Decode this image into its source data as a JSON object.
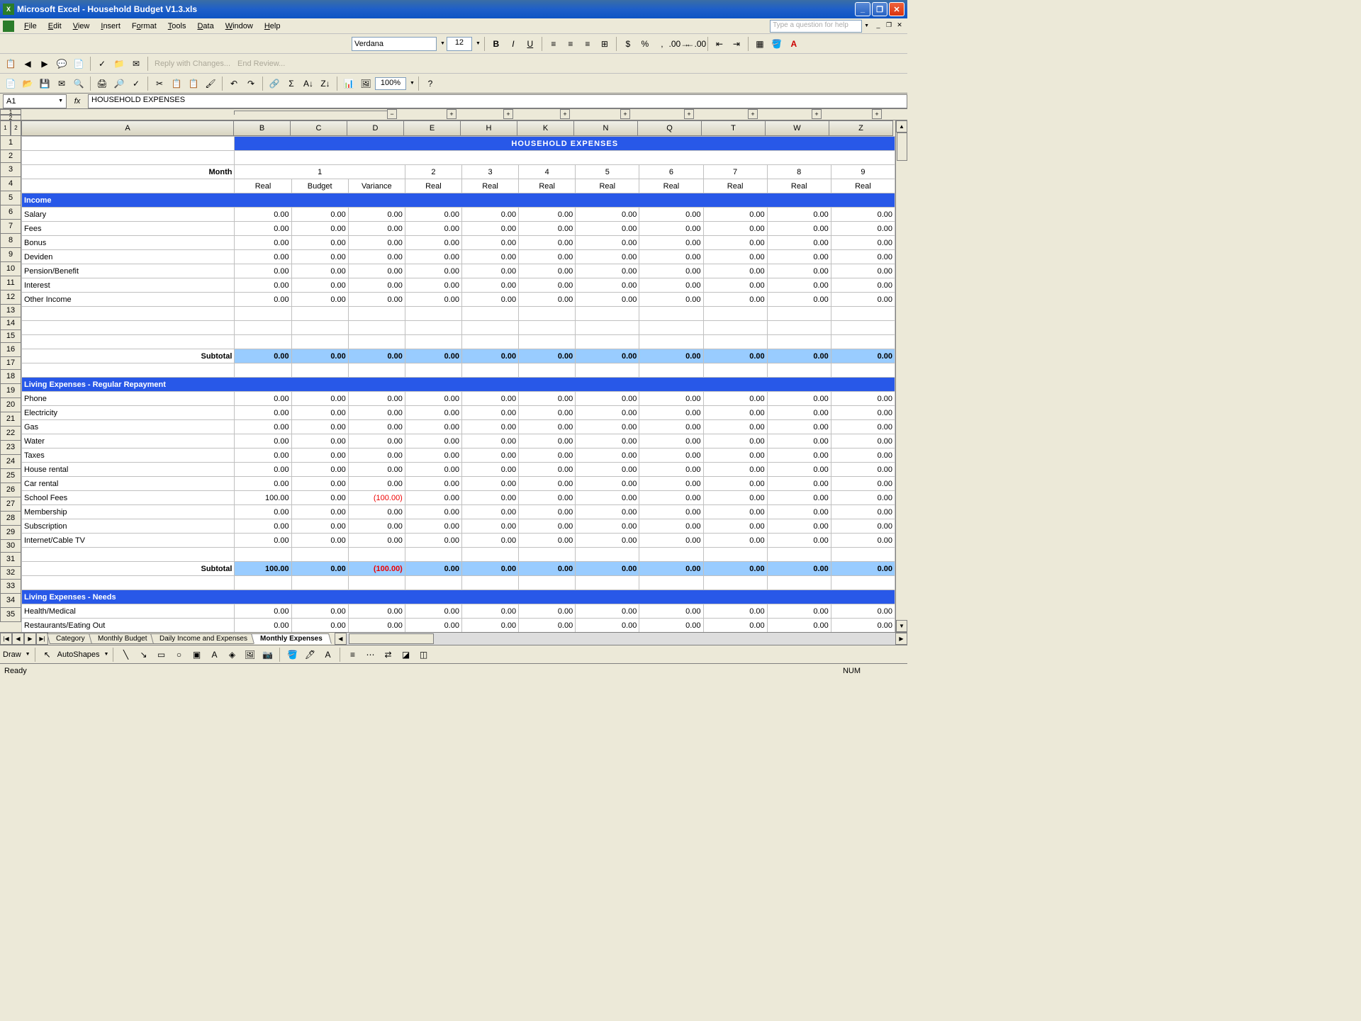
{
  "app": {
    "title": "Microsoft Excel - Household Budget V1.3.xls"
  },
  "menu": {
    "file": "File",
    "edit": "Edit",
    "view": "View",
    "insert": "Insert",
    "format": "Format",
    "tools": "Tools",
    "data": "Data",
    "window": "Window",
    "help": "Help",
    "help_box": "Type a question for help"
  },
  "font": {
    "name": "Verdana",
    "size": "12"
  },
  "toolbar2_text1": "Reply with Changes...",
  "toolbar2_text2": "End Review...",
  "zoom": "100%",
  "namebox": "A1",
  "fx": "fx",
  "formula": "HOUSEHOLD EXPENSES",
  "columns": [
    "A",
    "B",
    "C",
    "D",
    "E",
    "H",
    "K",
    "N",
    "Q",
    "T",
    "W",
    "Z"
  ],
  "row_nums": [
    "1",
    "2",
    "3",
    "4",
    "5",
    "6",
    "7",
    "8",
    "9",
    "10",
    "11",
    "12",
    "13",
    "14",
    "15",
    "16",
    "17",
    "18",
    "19",
    "20",
    "21",
    "22",
    "23",
    "24",
    "25",
    "26",
    "27",
    "28",
    "29",
    "30",
    "31",
    "32",
    "33",
    "34",
    "35"
  ],
  "header": "HOUSEHOLD EXPENSES",
  "month_label": "Month",
  "months": [
    "1",
    "2",
    "3",
    "4",
    "5",
    "6",
    "7",
    "8",
    "9"
  ],
  "subheaders_m1": [
    "Real",
    "Budget",
    "Variance"
  ],
  "subheader_other": "Real",
  "sections": {
    "income": "Income",
    "living_regular": "Living Expenses - Regular Repayment",
    "living_needs": "Living Expenses - Needs"
  },
  "income_rows": [
    "Salary",
    "Fees",
    "Bonus",
    "Deviden",
    "Pension/Benefit",
    "Interest",
    "Other Income"
  ],
  "living_regular_rows": [
    "Phone",
    "Electricity",
    "Gas",
    "Water",
    "Taxes",
    "House rental",
    "Car rental",
    "School Fees",
    "Membership",
    "Subscription",
    "Internet/Cable TV"
  ],
  "living_needs_rows": [
    "Health/Medical",
    "Restaurants/Eating Out"
  ],
  "subtotal_label": "Subtotal",
  "zero": "0.00",
  "school_fees_real": "100.00",
  "school_fees_var": "(100.00)",
  "living_subtotal_real": "100.00",
  "living_subtotal_var": "(100.00)",
  "tabs": {
    "t1": "Category",
    "t2": "Monthly Budget",
    "t3": "Daily Income and Expenses",
    "t4": "Monthly Expenses"
  },
  "draw": {
    "label": "Draw",
    "autoshapes": "AutoShapes"
  },
  "status": {
    "ready": "Ready",
    "num": "NUM"
  }
}
